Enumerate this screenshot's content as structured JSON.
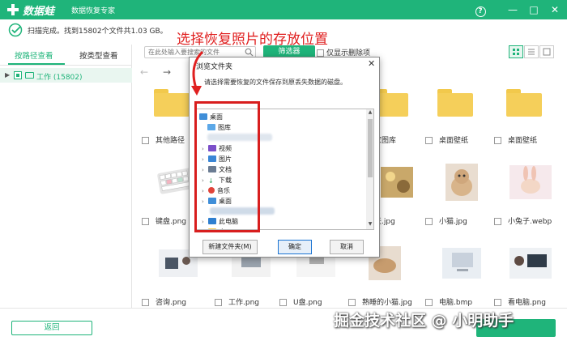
{
  "app": {
    "brand": "数据蛙",
    "subtitle": "数据恢复专家",
    "help": "?",
    "minimize": "—",
    "maximize": "□",
    "close": "✕",
    "colors": {
      "accent": "#1fb47a",
      "annotation": "#e02020"
    }
  },
  "status": {
    "text": "扫描完成。找到15802个文件共1.03 GB。"
  },
  "annotation": {
    "text": "选择恢复照片的存放位置"
  },
  "left_panel": {
    "tabs": [
      {
        "label": "按路径查看"
      },
      {
        "label": "按类型查看"
      }
    ],
    "tree": [
      {
        "label": "工作 (15802)"
      }
    ]
  },
  "toolbar": {
    "search_placeholder": "在此处输入要搜索的文件",
    "filter_label": "筛选器",
    "only_deleted_label": "仅显示删除项",
    "back": "←",
    "forward": "→"
  },
  "files": [
    {
      "label": "其他路径"
    },
    {
      "label": "家图库"
    },
    {
      "label": "桌面壁纸"
    },
    {
      "label": "桌面壁纸"
    },
    {
      "label": "键盘.png"
    },
    {
      "label": "天.jpg"
    },
    {
      "label": "小猫.jpg"
    },
    {
      "label": "小兔子.webp"
    },
    {
      "label": "咨询.png"
    },
    {
      "label": "工作.png"
    },
    {
      "label": "U盘.png"
    },
    {
      "label": "熟睡的小猫.jpg"
    },
    {
      "label": "电脑.bmp"
    },
    {
      "label": "看电脑.png"
    }
  ],
  "dialog": {
    "title": "浏览文件夹",
    "close": "✕",
    "description": "请选择需要恢复的文件保存到原丢失数据的磁盘。",
    "tree": [
      {
        "label": "桌面"
      },
      {
        "label": "图库"
      },
      {
        "label": "视频"
      },
      {
        "label": "图片"
      },
      {
        "label": "文档"
      },
      {
        "label": "下载"
      },
      {
        "label": "音乐"
      },
      {
        "label": "桌面"
      },
      {
        "label": "此电脑"
      },
      {
        "label": "库"
      }
    ],
    "new_folder": "新建文件夹(M)",
    "ok": "确定",
    "cancel": "取消"
  },
  "bottom": {
    "back_label": "返回",
    "watermark": "掘金技术社区 @ 小明助手"
  }
}
